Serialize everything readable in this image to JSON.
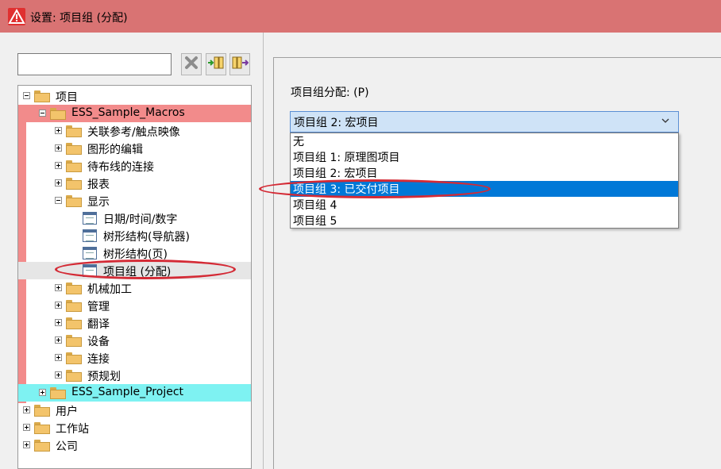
{
  "window": {
    "title": "设置: 项目组 (分配)"
  },
  "search": {
    "value": "",
    "placeholder": ""
  },
  "toolbar": [
    "clear-icon",
    "expand-columns-icon",
    "collapse-columns-icon"
  ],
  "tree": [
    {
      "label": "项目",
      "level": 0,
      "expander": "minus",
      "icon": "folder"
    },
    {
      "label": "ESS_Sample_Macros",
      "level": 1,
      "expander": "minus",
      "icon": "folder",
      "highlight": "red"
    },
    {
      "label": "关联参考/触点映像",
      "level": 2,
      "expander": "plus",
      "icon": "folder"
    },
    {
      "label": "图形的编辑",
      "level": 2,
      "expander": "plus",
      "icon": "folder"
    },
    {
      "label": "待布线的连接",
      "level": 2,
      "expander": "plus",
      "icon": "folder"
    },
    {
      "label": "报表",
      "level": 2,
      "expander": "plus",
      "icon": "folder"
    },
    {
      "label": "显示",
      "level": 2,
      "expander": "minus",
      "icon": "folder"
    },
    {
      "label": "日期/时间/数字",
      "level": 3,
      "expander": "",
      "icon": "page"
    },
    {
      "label": "树形结构(导航器)",
      "level": 3,
      "expander": "",
      "icon": "page"
    },
    {
      "label": "树形结构(页)",
      "level": 3,
      "expander": "",
      "icon": "page"
    },
    {
      "label": "项目组 (分配)",
      "level": 3,
      "expander": "",
      "icon": "page",
      "highlight": "gray"
    },
    {
      "label": "机械加工",
      "level": 2,
      "expander": "plus",
      "icon": "folder"
    },
    {
      "label": "管理",
      "level": 2,
      "expander": "plus",
      "icon": "folder"
    },
    {
      "label": "翻译",
      "level": 2,
      "expander": "plus",
      "icon": "folder"
    },
    {
      "label": "设备",
      "level": 2,
      "expander": "plus",
      "icon": "folder"
    },
    {
      "label": "连接",
      "level": 2,
      "expander": "plus",
      "icon": "folder"
    },
    {
      "label": "预规划",
      "level": 2,
      "expander": "plus",
      "icon": "folder"
    },
    {
      "label": "ESS_Sample_Project",
      "level": 1,
      "expander": "plus",
      "icon": "folder",
      "highlight": "cyan"
    },
    {
      "label": "用户",
      "level": 0,
      "expander": "plus",
      "icon": "folder"
    },
    {
      "label": "工作站",
      "level": 0,
      "expander": "plus",
      "icon": "folder"
    },
    {
      "label": "公司",
      "level": 0,
      "expander": "plus",
      "icon": "folder"
    }
  ],
  "settings": {
    "label": "项目组分配: (P)",
    "selected": "项目组 2: 宏项目",
    "options": [
      "无",
      "项目组 1: 原理图项目",
      "项目组 2: 宏项目",
      "项目组 3: 已交付项目",
      "项目组 4",
      "项目组 5"
    ],
    "highlighted_index": 3
  },
  "colors": {
    "titlebar": "#d97373",
    "highlight_red": "#f28b8b",
    "highlight_cyan": "#7ef2f2",
    "selection": "#0078d7",
    "annotation": "#d42a35"
  }
}
